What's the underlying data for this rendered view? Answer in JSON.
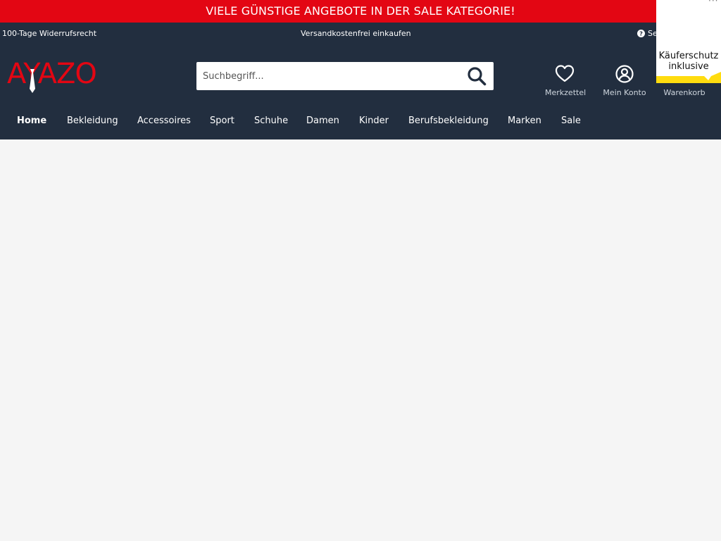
{
  "promo": {
    "text": "VIELE GÜNSTIGE ANGEBOTE IN DER SALE KATEGORIE!"
  },
  "topbar": {
    "left": "100-Tage Widerrufsrecht",
    "center": "Versandkostenfrei einkaufen",
    "service": "Se",
    "service_icon": "help-circle-icon"
  },
  "logo": {
    "text": "AYAZO",
    "color": "#e30613"
  },
  "search": {
    "placeholder": "Suchbegriff...",
    "value": "",
    "icon": "search-icon"
  },
  "actions": [
    {
      "label": "Merkzettel",
      "icon": "heart-icon"
    },
    {
      "label": "Mein Konto",
      "icon": "user-circle-icon"
    },
    {
      "label": "Warenkorb",
      "icon": "cart-icon"
    }
  ],
  "nav": {
    "items": [
      {
        "label": "Home",
        "active": true
      },
      {
        "label": "Bekleidung",
        "active": false
      },
      {
        "label": "Accessoires",
        "active": false
      },
      {
        "label": "Sport",
        "active": false
      },
      {
        "label": "Schuhe",
        "active": false
      },
      {
        "label": "Damen",
        "active": false
      },
      {
        "label": "Kinder",
        "active": false
      },
      {
        "label": "Berufsbekleidung",
        "active": false
      },
      {
        "label": "Marken",
        "active": false
      },
      {
        "label": "Sale",
        "active": false
      }
    ]
  },
  "trust_badge": {
    "dots": "···",
    "line1": "Käuferschutz",
    "line2": "inklusive",
    "ribbon_color": "#ffdc0f"
  },
  "colors": {
    "promo_bg": "#e30613",
    "header_bg": "#222e3f",
    "page_bg": "#f5f5f5"
  }
}
